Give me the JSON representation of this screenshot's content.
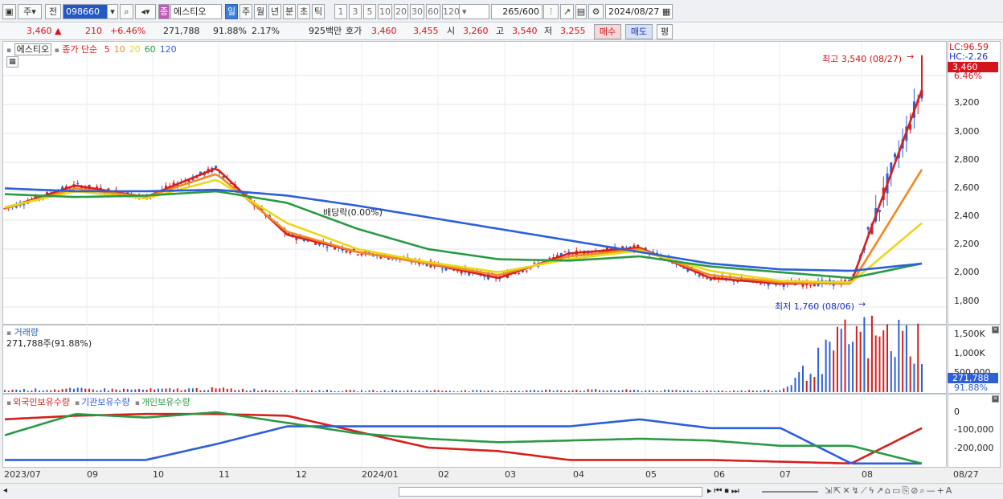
{
  "toolbar": {
    "market": "주",
    "prev": "전",
    "code": "098660",
    "name_badge": "종",
    "name": "에스티오",
    "periods": [
      "일",
      "주",
      "월",
      "년",
      "분",
      "초",
      "틱"
    ],
    "active_period": "일",
    "intervals": [
      "1",
      "3",
      "5",
      "10",
      "20",
      "30",
      "60",
      "120"
    ],
    "count": "265",
    "count_total": "/600",
    "date": "2024/08/27"
  },
  "quote": {
    "price": "3,460",
    "change": "210",
    "change_pct": "+6.46%",
    "volume": "271,788",
    "volume_ratio": "91.88%",
    "turnover": "2.17%",
    "amount": "925백만",
    "bid_label": "호가",
    "ask": "3,460",
    "bid": "3,455",
    "open_label": "시",
    "open": "3,260",
    "high_label": "고",
    "high": "3,540",
    "low_label": "저",
    "low": "3,255",
    "buy": "매수",
    "sell": "매도",
    "avg": "평"
  },
  "price_panel": {
    "name": "에스티오",
    "legend_label": "종가 단순",
    "ma": [
      {
        "period": "5",
        "color": "#d61f1f"
      },
      {
        "period": "10",
        "color": "#f0891f"
      },
      {
        "period": "20",
        "color": "#e8d81a"
      },
      {
        "period": "60",
        "color": "#2a9a45"
      },
      {
        "period": "120",
        "color": "#2d5fd6"
      }
    ],
    "lc": "LC:96.59",
    "hc": "HC:-2.26",
    "price_tag": "3,460",
    "pct_tag": "6.46%",
    "high_note": "최고 3,540 (08/27)",
    "low_note": "최저 1,760 (08/06)",
    "dividend_note": "배당락(0.00%)",
    "y_ticks": [
      "3,200",
      "3,000",
      "2,800",
      "2,600",
      "2,400",
      "2,200",
      "2,000",
      "1,800"
    ]
  },
  "volume_panel": {
    "title": "거래량",
    "info": "271,788주(91.88%)",
    "y_ticks": [
      "1,500K",
      "1,000K",
      "500,000"
    ],
    "vol_tag": "271,788",
    "pct_tag": "91.88%"
  },
  "holdings_panel": {
    "series": [
      {
        "name": "외국인보유수량",
        "color": "#d61f1f"
      },
      {
        "name": "기관보유수량",
        "color": "#2d5fd6"
      },
      {
        "name": "개인보유수량",
        "color": "#2a9a45"
      }
    ],
    "y_ticks": [
      "0",
      "-100,000",
      "-200,000"
    ]
  },
  "x_axis": [
    "2023/07",
    "09",
    "10",
    "11",
    "12",
    "2024/01",
    "02",
    "03",
    "04",
    "05",
    "06",
    "07",
    "08",
    "08/27"
  ],
  "chart_data": {
    "type": "line",
    "x": [
      "2023/07",
      "09",
      "10",
      "11",
      "12",
      "2024/01",
      "02",
      "03",
      "04",
      "05",
      "06",
      "07",
      "08",
      "08/27"
    ],
    "series": [
      {
        "name": "5",
        "values": [
          2480,
          2640,
          2560,
          2760,
          2300,
          2180,
          2100,
          2000,
          2170,
          2210,
          2000,
          1960,
          1970,
          3300
        ]
      },
      {
        "name": "10",
        "values": [
          2480,
          2620,
          2560,
          2720,
          2320,
          2180,
          2100,
          2020,
          2150,
          2200,
          2020,
          1970,
          1960,
          2750
        ]
      },
      {
        "name": "20",
        "values": [
          2490,
          2600,
          2550,
          2680,
          2380,
          2200,
          2110,
          2040,
          2130,
          2190,
          2050,
          1980,
          1970,
          2380
        ]
      },
      {
        "name": "60",
        "values": [
          2580,
          2560,
          2570,
          2600,
          2520,
          2340,
          2200,
          2130,
          2120,
          2150,
          2080,
          2040,
          2000,
          2100
        ]
      },
      {
        "name": "120",
        "values": [
          2620,
          2600,
          2600,
          2610,
          2570,
          2500,
          2420,
          2340,
          2260,
          2180,
          2100,
          2060,
          2050,
          2100
        ]
      }
    ],
    "volume": [
      60,
      80,
      70,
      90,
      50,
      40,
      45,
      35,
      60,
      50,
      40,
      45,
      1500,
      1400
    ],
    "holdings": [
      {
        "name": "외국인보유수량",
        "values": [
          -40000,
          -20000,
          -10000,
          -10000,
          -20000,
          -110000,
          -200000,
          -220000,
          -270000,
          -270000,
          -270000,
          -280000,
          -290000,
          -90000
        ]
      },
      {
        "name": "기관보유수량",
        "values": [
          -270000,
          -270000,
          -270000,
          -180000,
          -80000,
          -80000,
          -80000,
          -80000,
          -80000,
          -40000,
          -90000,
          -90000,
          -290000,
          -290000
        ]
      },
      {
        "name": "개인보유수량",
        "values": [
          -130000,
          -10000,
          -30000,
          0,
          -60000,
          -120000,
          -150000,
          -170000,
          -160000,
          -150000,
          -160000,
          -190000,
          -190000,
          -290000
        ]
      }
    ],
    "ylim": [
      1700,
      3600
    ]
  }
}
